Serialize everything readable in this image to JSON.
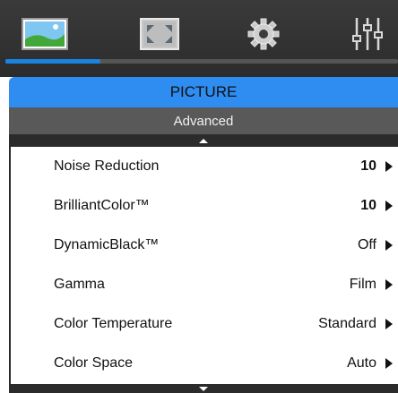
{
  "tabs": [
    {
      "icon": "picture-icon"
    },
    {
      "icon": "display-resize-icon"
    },
    {
      "icon": "gear-icon"
    },
    {
      "icon": "equalizer-icon"
    }
  ],
  "header": {
    "title": "PICTURE",
    "subtitle": "Advanced"
  },
  "items": [
    {
      "label": "Noise Reduction",
      "value": "10"
    },
    {
      "label": "BrilliantColor™",
      "value": "10"
    },
    {
      "label": "DynamicBlack™",
      "value": "Off"
    },
    {
      "label": "Gamma",
      "value": "Film"
    },
    {
      "label": "Color Temperature",
      "value": "Standard"
    },
    {
      "label": "Color Space",
      "value": "Auto"
    }
  ],
  "colors": {
    "accent": "#2f8cf0",
    "tab_indicator": "#1a82e0",
    "bar_dark": "#2b2b2b"
  }
}
